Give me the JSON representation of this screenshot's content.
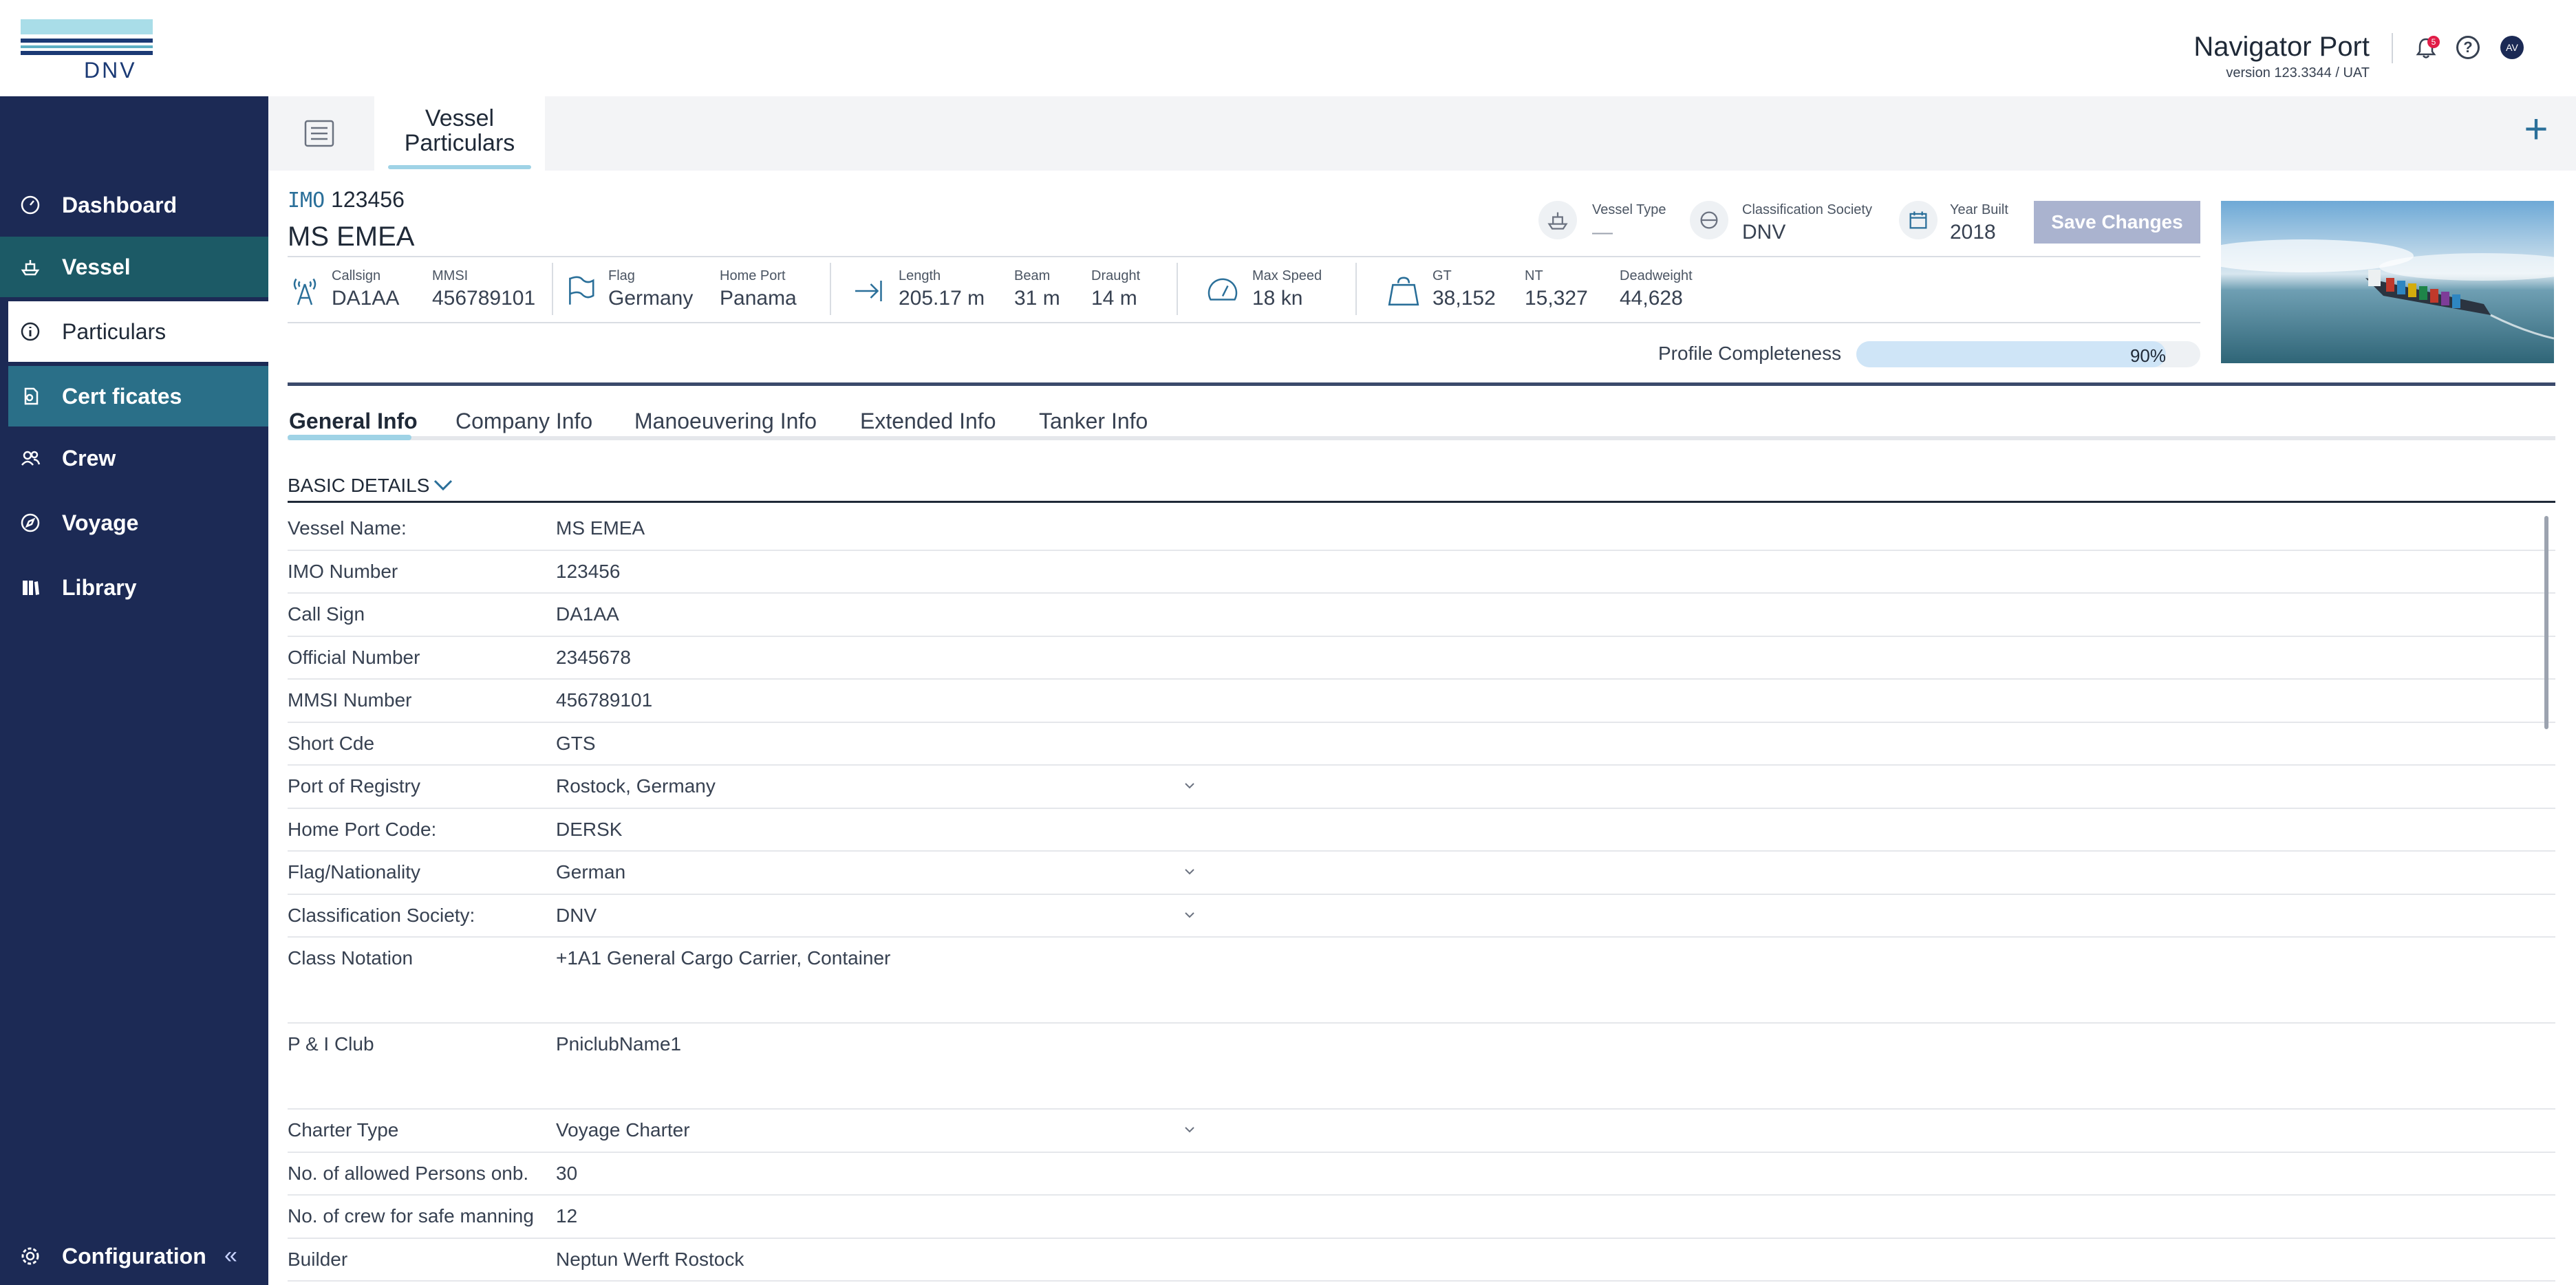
{
  "brand": {
    "logo_text": "DNV"
  },
  "header": {
    "app_name": "Navigator Port",
    "version": "version 123.3344 / UAT",
    "notification_count": "5",
    "avatar_initials": "AV",
    "help_glyph": "?"
  },
  "sidebar": {
    "items": [
      {
        "label": "Dashboard",
        "icon": "dashboard-icon"
      },
      {
        "label": "Vessel",
        "icon": "ship-icon"
      },
      {
        "label": "Particulars",
        "icon": "info-icon"
      },
      {
        "label": "Cert ficates",
        "icon": "certificate-icon"
      },
      {
        "label": "Crew",
        "icon": "people-icon"
      },
      {
        "label": "Voyage",
        "icon": "compass-icon"
      },
      {
        "label": "Library",
        "icon": "book-icon"
      }
    ],
    "config_label": "Configuration",
    "collapse_glyph": "«"
  },
  "tabbar": {
    "page_tab_line1": "Vessel",
    "page_tab_line2": "Particulars",
    "add_glyph": "+"
  },
  "vessel": {
    "imo_tag": "IMO",
    "imo": "123456",
    "name": "MS EMEA",
    "type_label": "Vessel Type",
    "type_value": "—",
    "class_label": "Classification Society",
    "class_value": "DNV",
    "year_label": "Year Built",
    "year_value": "2018",
    "save_label": "Save Changes",
    "stats": {
      "callsign_label": "Callsign",
      "callsign": "DA1AA",
      "mmsi_label": "MMSI",
      "mmsi": "456789101",
      "flag_label": "Flag",
      "flag": "Germany",
      "homeport_label": "Home Port",
      "homeport": "Panama",
      "length_label": "Length",
      "length": "205.17 m",
      "beam_label": "Beam",
      "beam": "31 m",
      "draught_label": "Draught",
      "draught": "14 m",
      "speed_label": "Max Speed",
      "speed": "18 kn",
      "gt_label": "GT",
      "gt": "38,152",
      "nt_label": "NT",
      "nt": "15,327",
      "dwt_label": "Deadweight",
      "dwt": "44,628"
    },
    "profile_label": "Profile Completeness",
    "profile_pct": "90%",
    "profile_fraction": 0.9
  },
  "info_tabs": [
    "General Info",
    "Company Info",
    "Manoeuvering Info",
    "Extended Info",
    "Tanker Info"
  ],
  "section": {
    "title": "BASIC DETAILS"
  },
  "details": [
    {
      "label": "Vessel Name:",
      "value": "MS EMEA"
    },
    {
      "label": "IMO Number",
      "value": "123456"
    },
    {
      "label": "Call Sign",
      "value": "DA1AA"
    },
    {
      "label": "Official Number",
      "value": "2345678"
    },
    {
      "label": "MMSI Number",
      "value": "456789101"
    },
    {
      "label": "Short Cde",
      "value": "GTS"
    },
    {
      "label": "Port of Registry",
      "value": "Rostock, Germany",
      "dropdown": true
    },
    {
      "label": "Home Port Code:",
      "value": "DERSK"
    },
    {
      "label": "Flag/Nationality",
      "value": "German",
      "dropdown": true
    },
    {
      "label": "Classification Society:",
      "value": "DNV",
      "dropdown": true
    },
    {
      "label": "Class Notation",
      "value": "+1A1 General Cargo Carrier, Container",
      "tall": true
    },
    {
      "label": "P & I Club",
      "value": "PniclubName1",
      "tall": true
    },
    {
      "label": "Charter Type",
      "value": "Voyage Charter",
      "dropdown": true
    },
    {
      "label": "No. of allowed Persons onb.",
      "value": "30"
    },
    {
      "label": "No. of crew for safe manning",
      "value": "12"
    },
    {
      "label": "Builder",
      "value": "Neptun Werft Rostock"
    }
  ]
}
